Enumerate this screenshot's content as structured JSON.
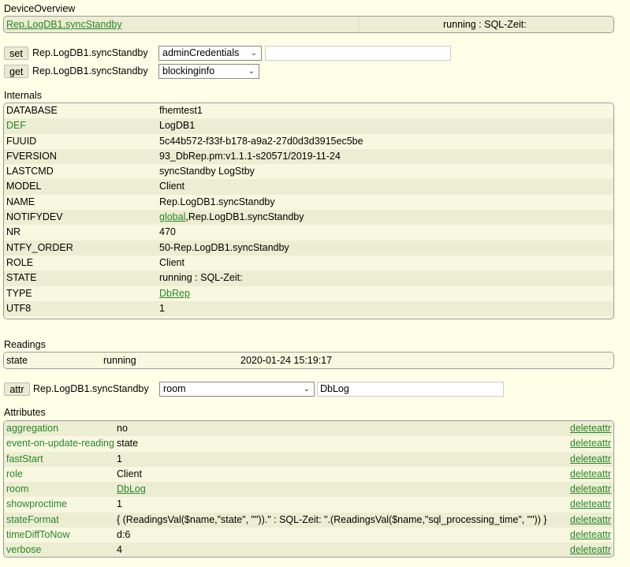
{
  "device_overview": {
    "heading": "DeviceOverview",
    "device_link": "Rep.LogDB1.syncStandby",
    "status": "running : SQL-Zeit:"
  },
  "set_row": {
    "button": "set",
    "device": "Rep.LogDB1.syncStandby",
    "selected": "adminCredentials",
    "value": ""
  },
  "get_row": {
    "button": "get",
    "device": "Rep.LogDB1.syncStandby",
    "selected": "blockinginfo"
  },
  "internals": {
    "heading": "Internals",
    "rows": [
      {
        "name": "DATABASE",
        "value": "fhemtest1",
        "name_link": false
      },
      {
        "name": "DEF",
        "value": "LogDB1",
        "name_link": true
      },
      {
        "name": "FUUID",
        "value": "5c44b572-f33f-b178-a9a2-27d0d3d3915ec5be",
        "name_link": false
      },
      {
        "name": "FVERSION",
        "value": "93_DbRep.pm:v1.1.1-s20571/2019-11-24",
        "name_link": false
      },
      {
        "name": "LASTCMD",
        "value": "syncStandby LogStby",
        "name_link": false
      },
      {
        "name": "MODEL",
        "value": "Client",
        "name_link": false
      },
      {
        "name": "NAME",
        "value": "Rep.LogDB1.syncStandby",
        "name_link": false
      },
      {
        "name": "NOTIFYDEV",
        "value_link": "global",
        "value": ",Rep.LogDB1.syncStandby",
        "name_link": false
      },
      {
        "name": "NR",
        "value": "470",
        "name_link": false
      },
      {
        "name": "NTFY_ORDER",
        "value": "50-Rep.LogDB1.syncStandby",
        "name_link": false
      },
      {
        "name": "ROLE",
        "value": "Client",
        "name_link": false
      },
      {
        "name": "STATE",
        "value": "running : SQL-Zeit:",
        "name_link": false
      },
      {
        "name": "TYPE",
        "value_link": "DbRep",
        "value": "",
        "name_link": false
      },
      {
        "name": "UTF8",
        "value": "1",
        "name_link": false
      }
    ]
  },
  "readings": {
    "heading": "Readings",
    "rows": [
      {
        "name": "state",
        "value": "running",
        "time": "2020-01-24 15:19:17"
      }
    ]
  },
  "attr_row": {
    "button": "attr",
    "device": "Rep.LogDB1.syncStandby",
    "selected": "room",
    "value": "DbLog"
  },
  "attributes": {
    "heading": "Attributes",
    "delete_label": "deleteattr",
    "rows": [
      {
        "name": "aggregation",
        "value": "no"
      },
      {
        "name": "event-on-update-reading",
        "value": "state"
      },
      {
        "name": "fastStart",
        "value": "1"
      },
      {
        "name": "role",
        "value": "Client"
      },
      {
        "name": "room",
        "value_link": "DbLog",
        "value": ""
      },
      {
        "name": "showproctime",
        "value": "1"
      },
      {
        "name": "stateFormat",
        "value": "{ (ReadingsVal($name,\"state\", \"\")).\" : SQL-Zeit: \".(ReadingsVal($name,\"sql_processing_time\", \"\")) }"
      },
      {
        "name": "timeDiffToNow",
        "value": "d:6"
      },
      {
        "name": "verbose",
        "value": "4"
      }
    ]
  },
  "colors": {
    "background": "#FFFFE7",
    "link": "#278727",
    "row_alt": "#EDEDD3"
  }
}
